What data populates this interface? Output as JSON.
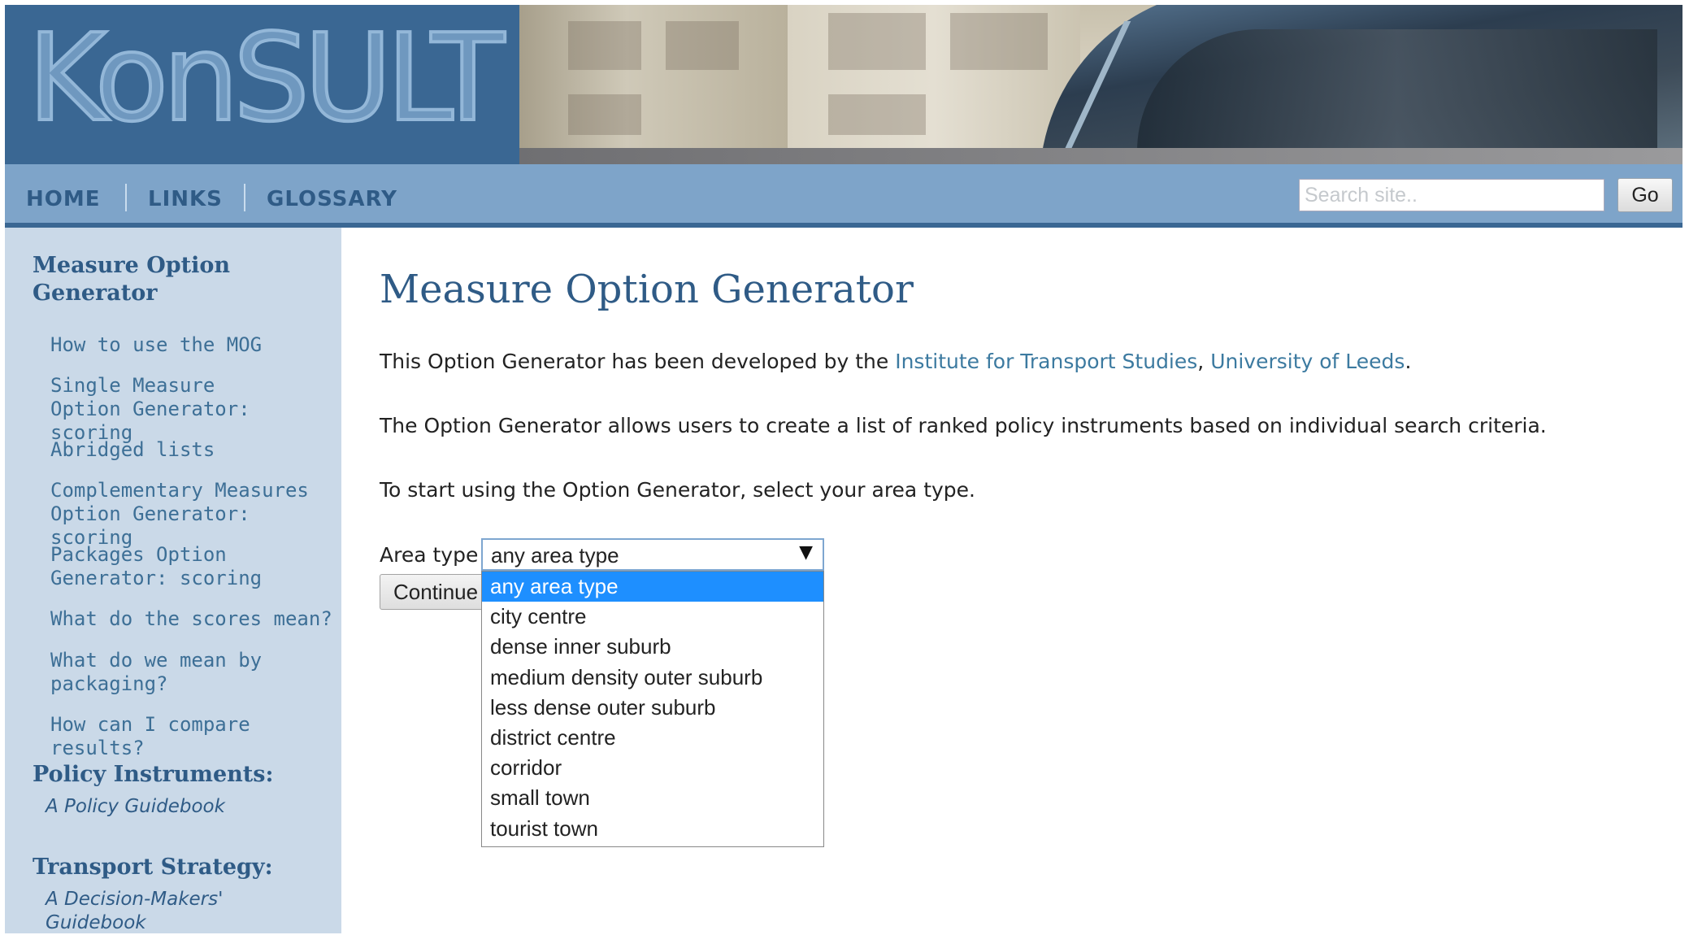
{
  "banner": {
    "logo": "KonSULT"
  },
  "nav": {
    "items": [
      "HOME",
      "LINKS",
      "GLOSSARY"
    ],
    "search_placeholder": "Search site..",
    "go_label": "Go"
  },
  "sidebar": {
    "section_title": "Measure Option Generator",
    "links": [
      "How to use the MOG",
      "Single Measure Option Generator: scoring",
      "Abridged lists",
      "Complementary Measures Option Generator: scoring",
      "Packages Option Generator: scoring",
      "What do the scores mean?",
      "What do we mean by packaging?",
      "How can I compare results?"
    ],
    "policy": {
      "title": "Policy Instruments:",
      "subtitle": "A Policy Guidebook"
    },
    "transport": {
      "title": "Transport Strategy:",
      "subtitle": "A Decision-Makers' Guidebook"
    }
  },
  "main": {
    "title": "Measure Option Generator",
    "p1_before": "This Option Generator has been developed by the ",
    "p1_link1": "Institute for Transport Studies",
    "p1_comma": ", ",
    "p1_link2": "University of Leeds",
    "p1_after": ".",
    "p2": "The Option Generator allows users to create a list of ranked policy instruments based on individual search criteria.",
    "p3": "To start using the Option Generator, select your area type.",
    "area_label": "Area type",
    "continue_label": "Continue",
    "select": {
      "value": "any area type",
      "arrow": "▼",
      "options": [
        "any area type",
        "city centre",
        "dense inner suburb",
        "medium density outer suburb",
        "less dense outer suburb",
        "district centre",
        "corridor",
        "small town",
        "tourist town"
      ],
      "highlighted_index": 0
    }
  },
  "colors": {
    "brand": "#3a6793",
    "nav": "#7ea4c9",
    "sidebar": "#cad9e8",
    "link": "#3c7aa0",
    "highlight": "#1e8fff"
  }
}
